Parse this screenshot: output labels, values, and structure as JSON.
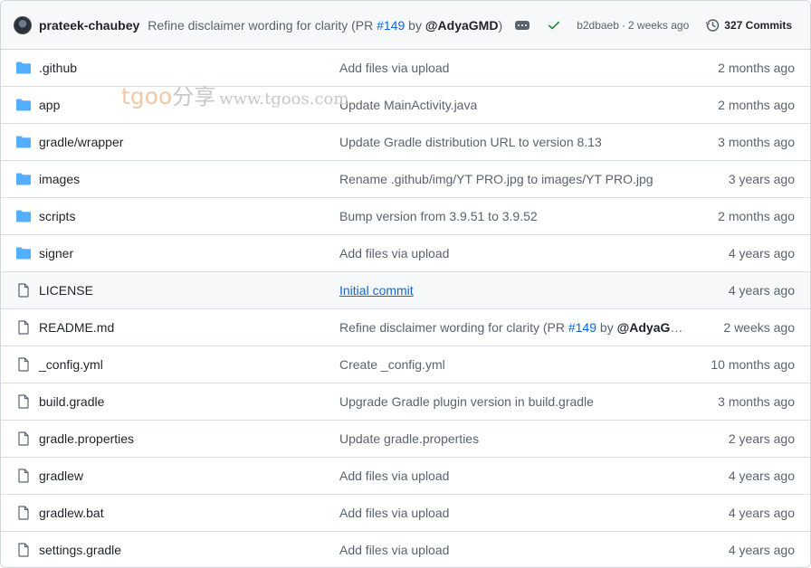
{
  "commit_header": {
    "author": "prateek-chaubey",
    "message_prefix": "Refine disclaimer wording for clarity (PR ",
    "pr_number": "#149",
    "message_by": " by ",
    "mention": "@AdyaGMD",
    "message_suffix": ")",
    "sha": "b2dbaeb",
    "separator": "·",
    "time_ago": "2 weeks ago",
    "commits_label": "327 Commits"
  },
  "watermark": {
    "part1": "tgoo",
    "part2": "分享",
    "part3": "www.tgoos.com"
  },
  "files": [
    {
      "type": "folder",
      "name": ".github",
      "message": "Add files via upload",
      "time": "2 months ago"
    },
    {
      "type": "folder",
      "name": "app",
      "message": "Update MainActivity.java",
      "time": "2 months ago"
    },
    {
      "type": "folder",
      "name": "gradle/wrapper",
      "message": "Update Gradle distribution URL to version 8.13",
      "time": "3 months ago"
    },
    {
      "type": "folder",
      "name": "images",
      "message": "Rename .github/img/YT PRO.jpg to images/YT PRO.jpg",
      "time": "3 years ago"
    },
    {
      "type": "folder",
      "name": "scripts",
      "message": "Bump version from 3.9.51 to 3.9.52",
      "time": "2 months ago"
    },
    {
      "type": "folder",
      "name": "signer",
      "message": "Add files via upload",
      "time": "4 years ago"
    },
    {
      "type": "file",
      "name": "LICENSE",
      "message": "Initial commit",
      "time": "4 years ago"
    },
    {
      "type": "file",
      "name": "README.md",
      "message": "Refine disclaimer wording for clarity (PR ",
      "message_pr": "#149",
      "message_by": " by ",
      "message_mention": "@AdyaGM…",
      "time": "2 weeks ago"
    },
    {
      "type": "file",
      "name": "_config.yml",
      "message": "Create _config.yml",
      "time": "10 months ago"
    },
    {
      "type": "file",
      "name": "build.gradle",
      "message": "Upgrade Gradle plugin version in build.gradle",
      "time": "3 months ago"
    },
    {
      "type": "file",
      "name": "gradle.properties",
      "message": "Update gradle.properties",
      "time": "2 years ago"
    },
    {
      "type": "file",
      "name": "gradlew",
      "message": "Add files via upload",
      "time": "4 years ago"
    },
    {
      "type": "file",
      "name": "gradlew.bat",
      "message": "Add files via upload",
      "time": "4 years ago"
    },
    {
      "type": "file",
      "name": "settings.gradle",
      "message": "Add files via upload",
      "time": "4 years ago"
    }
  ],
  "colors": {
    "folder": "#54aeff",
    "file_icon": "#59636e",
    "link": "#0969da",
    "check": "#1a7f37"
  }
}
